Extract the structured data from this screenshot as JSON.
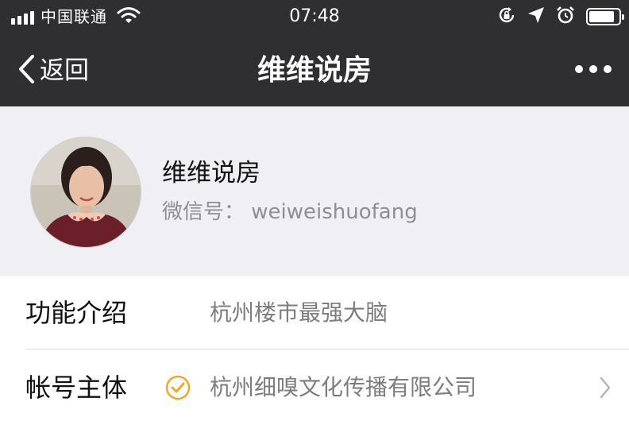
{
  "status_bar": {
    "carrier": "中国联通",
    "time": "07:48",
    "signal_icon": "signal-bars-icon",
    "wifi_icon": "wifi-icon",
    "right_icons": [
      "rotation-lock-icon",
      "location-arrow-icon",
      "alarm-clock-icon",
      "battery-icon"
    ],
    "battery_level": 0.85
  },
  "nav": {
    "back_label": "返回",
    "title": "维维说房",
    "more_icon": "more-dots-icon"
  },
  "profile": {
    "name": "维维说房",
    "wechat_id": "微信号： weiweishuofang"
  },
  "info_rows": [
    {
      "label": "功能介绍",
      "value": "杭州楼市最强大脑"
    },
    {
      "label": "帐号主体",
      "value": "杭州细嗅文化传播有限公司",
      "verified_icon": "verified-check-icon",
      "chevron_icon": "chevron-right-icon"
    }
  ],
  "colors": {
    "bar_background": "#2f2f31",
    "profile_background": "#efeff4",
    "verified_accent": "#f5a623",
    "secondary_text": "#8e8e93"
  }
}
